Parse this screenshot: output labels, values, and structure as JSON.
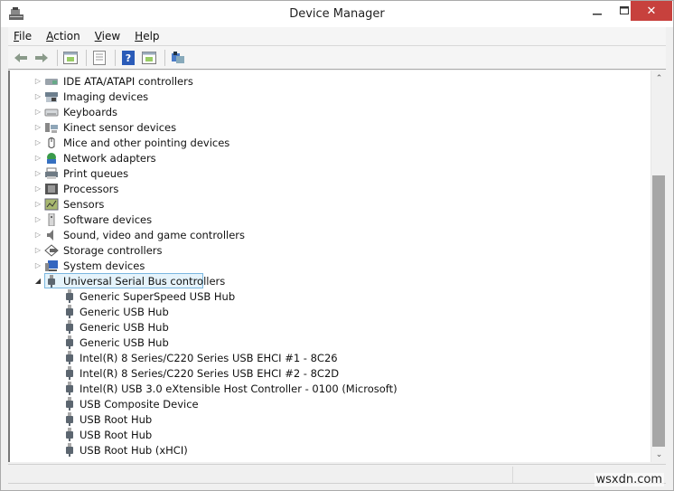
{
  "window": {
    "title": "Device Manager",
    "app_icon": "device-manager-icon",
    "controls": {
      "minimize": "—",
      "maximize": "☐",
      "close": "✕"
    }
  },
  "menubar": {
    "items": [
      {
        "label": "File",
        "accel": "F",
        "rest": "ile"
      },
      {
        "label": "Action",
        "accel": "A",
        "rest": "ction"
      },
      {
        "label": "View",
        "accel": "V",
        "rest": "iew"
      },
      {
        "label": "Help",
        "accel": "H",
        "rest": "elp"
      }
    ]
  },
  "toolbar": {
    "buttons": [
      {
        "name": "back-button",
        "icon": "arrow-left-icon"
      },
      {
        "name": "forward-button",
        "icon": "arrow-right-icon"
      },
      {
        "name": "show-hide-console-tree-button",
        "icon": "console-tree-icon"
      },
      {
        "name": "properties-button",
        "icon": "properties-icon"
      },
      {
        "name": "help-button",
        "icon": "help-icon"
      },
      {
        "name": "show-action-pane-button",
        "icon": "action-pane-icon"
      },
      {
        "name": "scan-hardware-button",
        "icon": "scan-hardware-icon"
      }
    ]
  },
  "tree": {
    "categories": [
      {
        "label": "IDE ATA/ATAPI controllers",
        "icon": "ide-controller-icon",
        "expanded": false
      },
      {
        "label": "Imaging devices",
        "icon": "imaging-device-icon",
        "expanded": false
      },
      {
        "label": "Keyboards",
        "icon": "keyboard-icon",
        "expanded": false
      },
      {
        "label": "Kinect sensor devices",
        "icon": "kinect-icon",
        "expanded": false
      },
      {
        "label": "Mice and other pointing devices",
        "icon": "mouse-icon",
        "expanded": false
      },
      {
        "label": "Network adapters",
        "icon": "network-adapter-icon",
        "expanded": false
      },
      {
        "label": "Print queues",
        "icon": "printer-icon",
        "expanded": false
      },
      {
        "label": "Processors",
        "icon": "processor-icon",
        "expanded": false
      },
      {
        "label": "Sensors",
        "icon": "sensor-icon",
        "expanded": false
      },
      {
        "label": "Software devices",
        "icon": "software-device-icon",
        "expanded": false
      },
      {
        "label": "Sound, video and game controllers",
        "icon": "speaker-icon",
        "expanded": false
      },
      {
        "label": "Storage controllers",
        "icon": "storage-controller-icon",
        "expanded": false
      },
      {
        "label": "System devices",
        "icon": "system-device-icon",
        "expanded": false
      },
      {
        "label": "Universal Serial Bus controllers",
        "icon": "usb-icon",
        "expanded": true,
        "selected": true
      }
    ],
    "usb_children": [
      "Generic SuperSpeed USB Hub",
      "Generic USB Hub",
      "Generic USB Hub",
      "Generic USB Hub",
      "Intel(R) 8 Series/C220 Series USB EHCI #1 - 8C26",
      "Intel(R) 8 Series/C220 Series USB EHCI #2 - 8C2D",
      "Intel(R) USB 3.0 eXtensible Host Controller - 0100 (Microsoft)",
      "USB Composite Device",
      "USB Root Hub",
      "USB Root Hub",
      "USB Root Hub (xHCI)"
    ],
    "expander_collapsed": "▷",
    "expander_expanded": "◢"
  },
  "scrollbar": {
    "up": "⌃",
    "down": "⌄"
  },
  "watermark": "wsxdn.com",
  "colors": {
    "close_button": "#c7413d",
    "selection_bg": "#e5f3fb",
    "selection_border": "#7ab7e0",
    "scroll_thumb": "#a6a6a6"
  }
}
